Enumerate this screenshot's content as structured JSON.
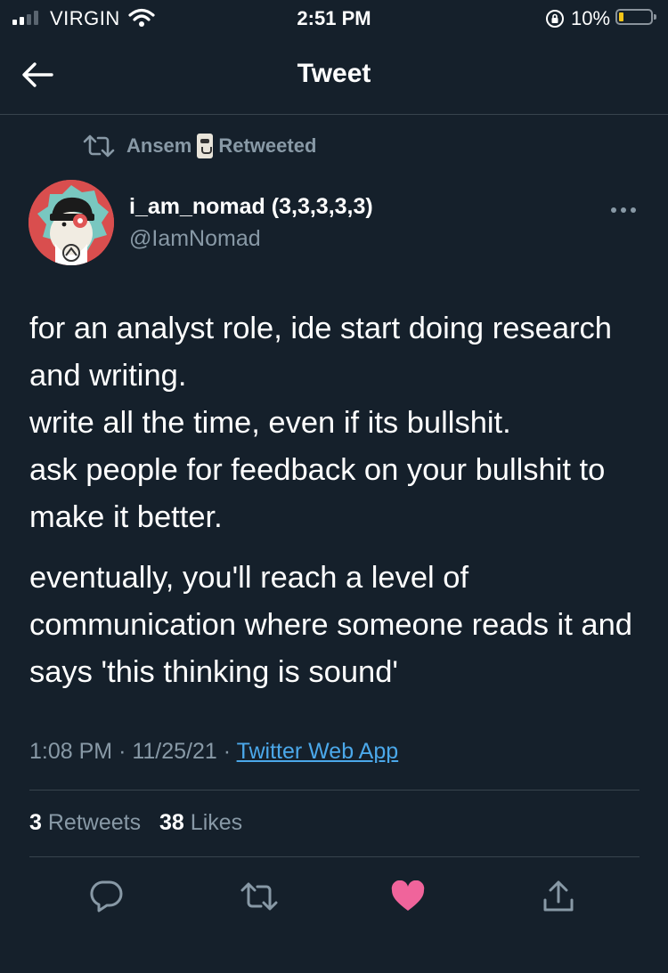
{
  "status_bar": {
    "carrier": "VIRGIN",
    "time": "2:51 PM",
    "battery_percent": "10%",
    "signal_bars": 2,
    "battery_level": 0.1,
    "battery_color": "#f5c518"
  },
  "header": {
    "title": "Tweet",
    "back_icon": "arrow-left-icon"
  },
  "retweet": {
    "user": "Ansem",
    "label": "Retweeted",
    "icon": "retweet-icon"
  },
  "author": {
    "name": "i_am_nomad (3,3,3,3,3)",
    "handle": "@IamNomad",
    "avatar_bg": "#d94e4e"
  },
  "tweet": {
    "paragraphs": [
      "for an analyst role, ide start doing research and writing.\nwrite all the time, even if its bullshit.\nask people for feedback on your bullshit to make it better.",
      "eventually, you'll reach a level of communication where someone reads it and says 'this thinking is sound'"
    ]
  },
  "meta": {
    "time": "1:08 PM",
    "date": "11/25/21",
    "source": "Twitter Web App",
    "separator": "·"
  },
  "stats": {
    "retweets_count": "3",
    "retweets_label": "Retweets",
    "likes_count": "38",
    "likes_label": "Likes"
  },
  "actions": {
    "reply_icon": "reply-icon",
    "retweet_icon": "retweet-icon",
    "like_icon": "heart-icon",
    "share_icon": "share-icon",
    "liked": true,
    "like_color": "#f0649b"
  },
  "colors": {
    "background": "#15202b",
    "secondary_text": "#8899a6",
    "link": "#4ba8ea",
    "divider": "#38444d"
  }
}
